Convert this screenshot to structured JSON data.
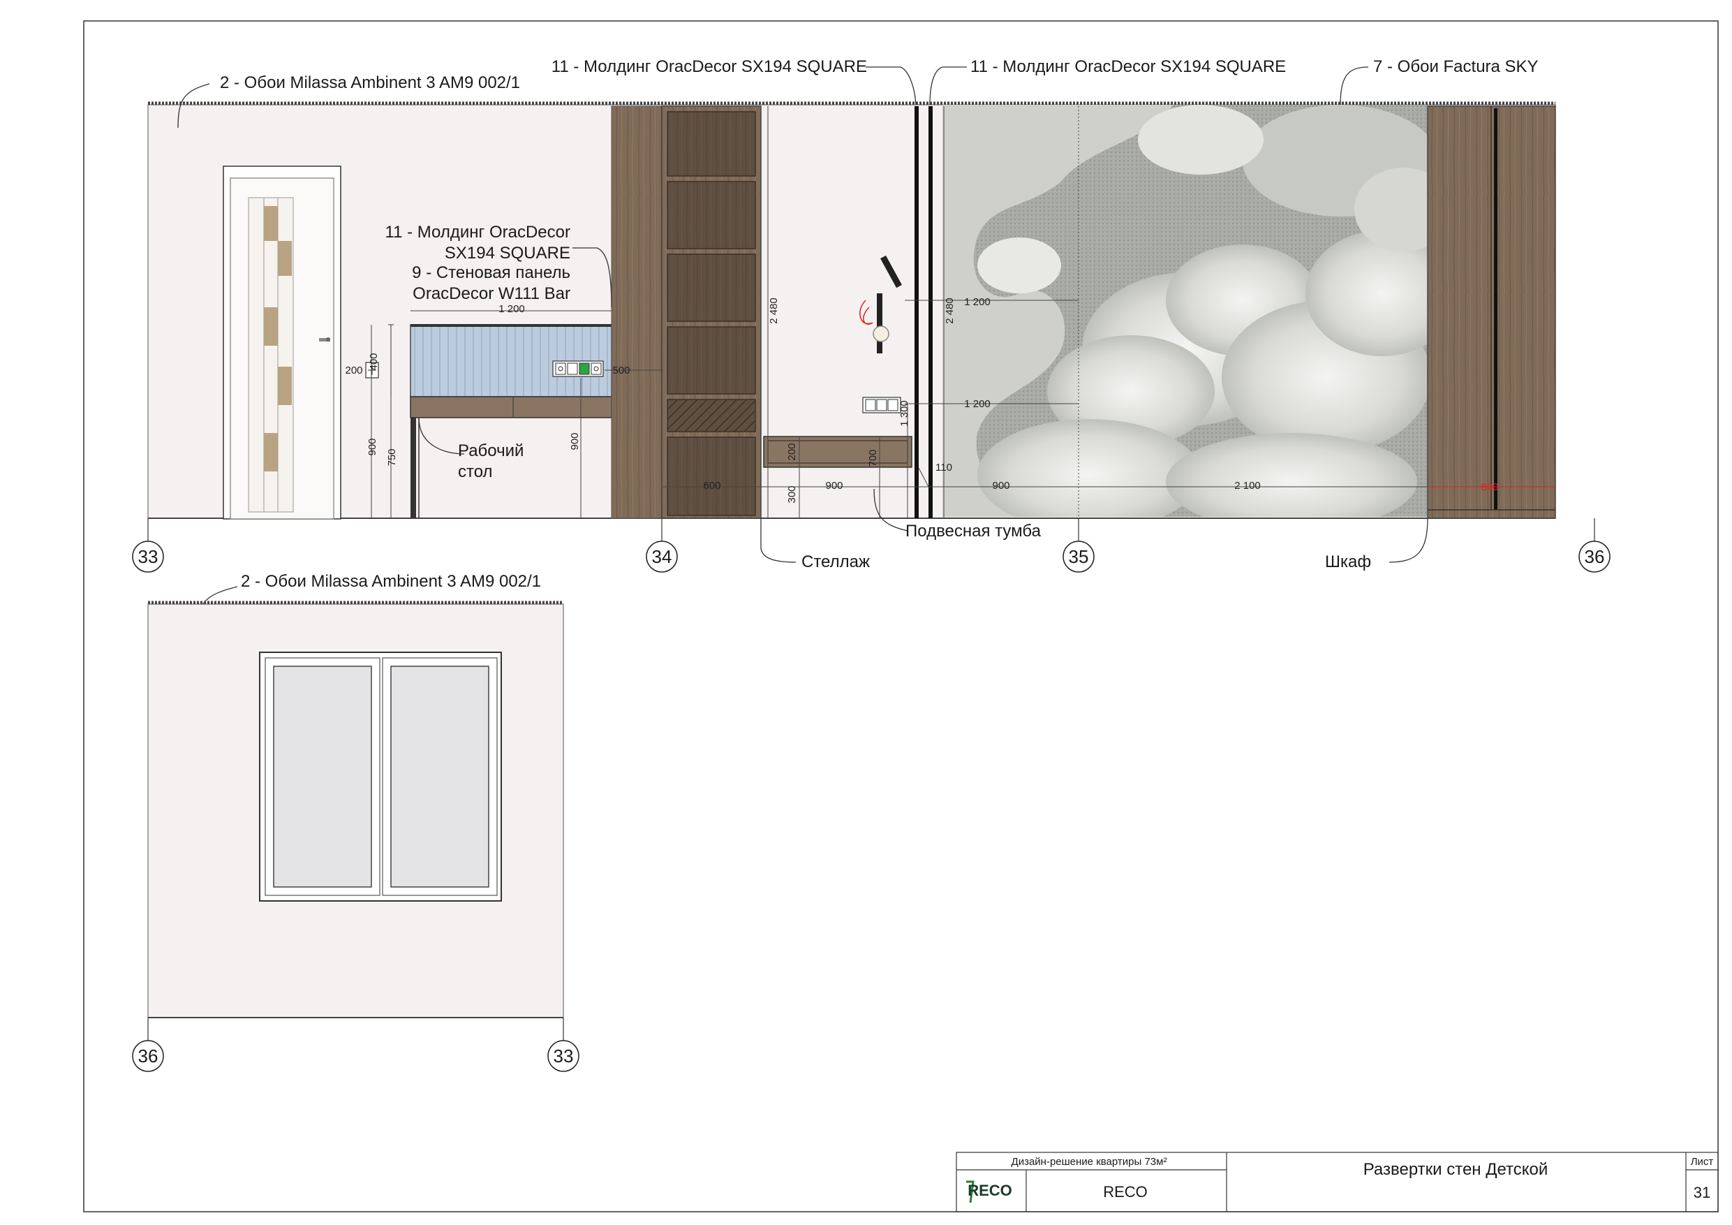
{
  "labels": {
    "wallpaper_1": "2 - Обои Milassa Ambinent 3 AM9 002/1",
    "molding_1": "11 - Молдинг OracDecor SX194 SQUARE",
    "molding_2": "11 - Молдинг OracDecor SX194 SQUARE",
    "wallpaper_sky": "7 - Обои Factura SKY",
    "molding_3_line1": "11 - Молдинг OracDecor",
    "molding_3_line2": "SX194 SQUARE",
    "panel_line1": "9 - Стеновая панель",
    "panel_line2": "OracDecor W111 Bar",
    "desk_line1": "Рабочий",
    "desk_line2": "стол",
    "shelf": "Стеллаж",
    "cabinet": "Подвесная тумба",
    "wardrobe": "Шкаф",
    "wallpaper_2": "2 - Обои Milassa Ambinent 3 AM9 002/1"
  },
  "axes": {
    "a33": "33",
    "a34": "34",
    "a35": "35",
    "a36": "36",
    "b36": "36",
    "b33": "33"
  },
  "dimensions": {
    "d1200a": "1 200",
    "d400": "400",
    "d500": "500",
    "d200a": "200",
    "d900a": "900",
    "d750": "750",
    "d900b": "900",
    "d2480a": "2 480",
    "d200b": "200",
    "d300a": "300",
    "d600": "600",
    "d900c": "900",
    "d700": "700",
    "d2480b": "2 480",
    "d1300": "1 300",
    "d1200b": "1 200",
    "d1200c": "1 200",
    "d110": "110",
    "d900d": "900",
    "d2100": "2 100",
    "d800": "800"
  },
  "title_block": {
    "project": "Дизайн-решение квартиры 73м²",
    "logo": "RECO",
    "company": "RECO",
    "sheet_title": "Развертки стен Детской",
    "sheet_label": "Лист",
    "sheet_number": "31"
  },
  "colors": {
    "wall": "#f4f1f0",
    "wood": "#7d6a57",
    "wood_dark": "#5e4e3f",
    "panel_blue": "#b9c9dc",
    "dimension_red": "#e02020"
  }
}
